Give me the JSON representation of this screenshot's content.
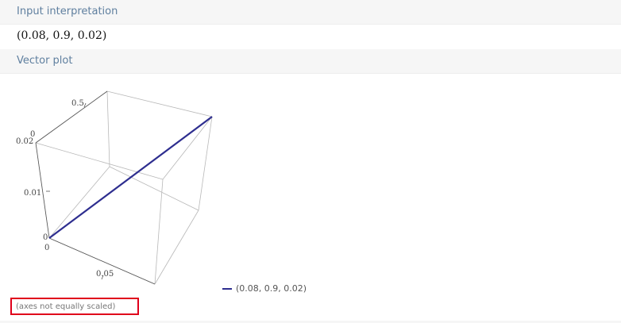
{
  "pods": {
    "input": {
      "title": "Input interpretation",
      "value": "(0.08, 0.9, 0.02)"
    },
    "plot": {
      "title": "Vector plot",
      "note": "(axes not equally scaled)"
    }
  },
  "chart_data": {
    "type": "line",
    "vector": [
      0.08,
      0.9,
      0.02
    ],
    "series": [
      {
        "name": "(0.08, 0.9, 0.02)",
        "color": "#2e2e8f",
        "from": [
          0,
          0,
          0
        ],
        "to": [
          0.08,
          0.9,
          0.02
        ]
      }
    ],
    "tick_labels": {
      "x": [
        "0",
        "0.05"
      ],
      "y": [
        "0.5"
      ],
      "z": [
        "0",
        "0.01",
        "0.02"
      ],
      "origin": [
        "0",
        "0"
      ]
    },
    "grid": false
  },
  "colors": {
    "header_text": "#5f7f9f",
    "header_bg": "#f6f6f6",
    "highlight_border": "#e0001b",
    "vector": "#2e2e8f"
  }
}
